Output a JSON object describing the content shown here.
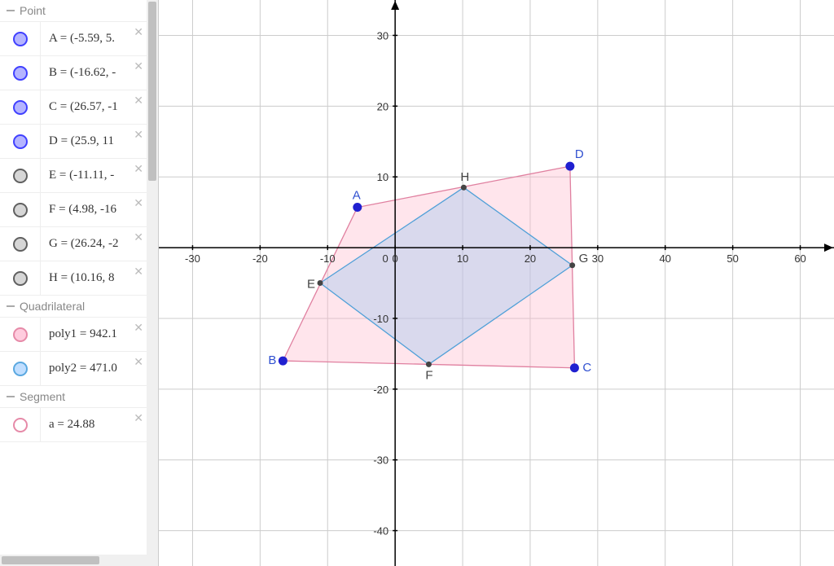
{
  "sidebar": {
    "categories": [
      {
        "name": "Point",
        "items": [
          {
            "name": "A",
            "expr": "A = (-5.59, 5.",
            "dotClass": "blue-dot"
          },
          {
            "name": "B",
            "expr": "B = (-16.62, -",
            "dotClass": "blue-dot"
          },
          {
            "name": "C",
            "expr": "C = (26.57, -1",
            "dotClass": "blue-dot"
          },
          {
            "name": "D",
            "expr": "D = (25.9, 11",
            "dotClass": "blue-dot"
          },
          {
            "name": "E",
            "expr": "E = (-11.11, -",
            "dotClass": "gray-dot"
          },
          {
            "name": "F",
            "expr": "F = (4.98, -16",
            "dotClass": "gray-dot"
          },
          {
            "name": "G",
            "expr": "G = (26.24, -2",
            "dotClass": "gray-dot"
          },
          {
            "name": "H",
            "expr": "H = (10.16, 8",
            "dotClass": "gray-dot"
          }
        ]
      },
      {
        "name": "Quadrilateral",
        "items": [
          {
            "name": "poly1",
            "expr": "poly1 = 942.1",
            "dotClass": "pink-dot"
          },
          {
            "name": "poly2",
            "expr": "poly2 = 471.0",
            "dotClass": "lblue-dot"
          }
        ]
      },
      {
        "name": "Segment",
        "items": [
          {
            "name": "a",
            "expr": "a = 24.88",
            "dotClass": "pinkb-dot"
          }
        ]
      }
    ]
  },
  "chart_data": {
    "type": "scatter",
    "title": "",
    "xlabel": "",
    "ylabel": "",
    "xlim": [
      -35,
      65
    ],
    "ylim": [
      -45,
      35
    ],
    "grid": true,
    "points": [
      {
        "label": "A",
        "x": -5.59,
        "y": 5.7,
        "color": "blue"
      },
      {
        "label": "B",
        "x": -16.62,
        "y": -16.0,
        "color": "blue"
      },
      {
        "label": "C",
        "x": 26.57,
        "y": -17.0,
        "color": "blue"
      },
      {
        "label": "D",
        "x": 25.9,
        "y": 11.5,
        "color": "blue"
      },
      {
        "label": "E",
        "x": -11.11,
        "y": -5.0,
        "color": "gray"
      },
      {
        "label": "F",
        "x": 4.98,
        "y": -16.5,
        "color": "gray"
      },
      {
        "label": "G",
        "x": 26.24,
        "y": -2.5,
        "color": "gray"
      },
      {
        "label": "H",
        "x": 10.16,
        "y": 8.5,
        "color": "gray"
      }
    ],
    "polygons": [
      {
        "name": "poly1",
        "vertices": [
          "A",
          "B",
          "C",
          "D"
        ],
        "area": 942.1,
        "style": "pink"
      },
      {
        "name": "poly2",
        "vertices": [
          "E",
          "F",
          "G",
          "H"
        ],
        "area": 471.0,
        "style": "lightblue"
      }
    ],
    "segments": [
      {
        "name": "a",
        "length": 24.88
      }
    ],
    "xticks": [
      -30,
      -20,
      -10,
      0,
      10,
      20,
      30,
      40,
      50,
      60
    ],
    "yticks": [
      -40,
      -30,
      -20,
      -10,
      10,
      20,
      30
    ]
  }
}
